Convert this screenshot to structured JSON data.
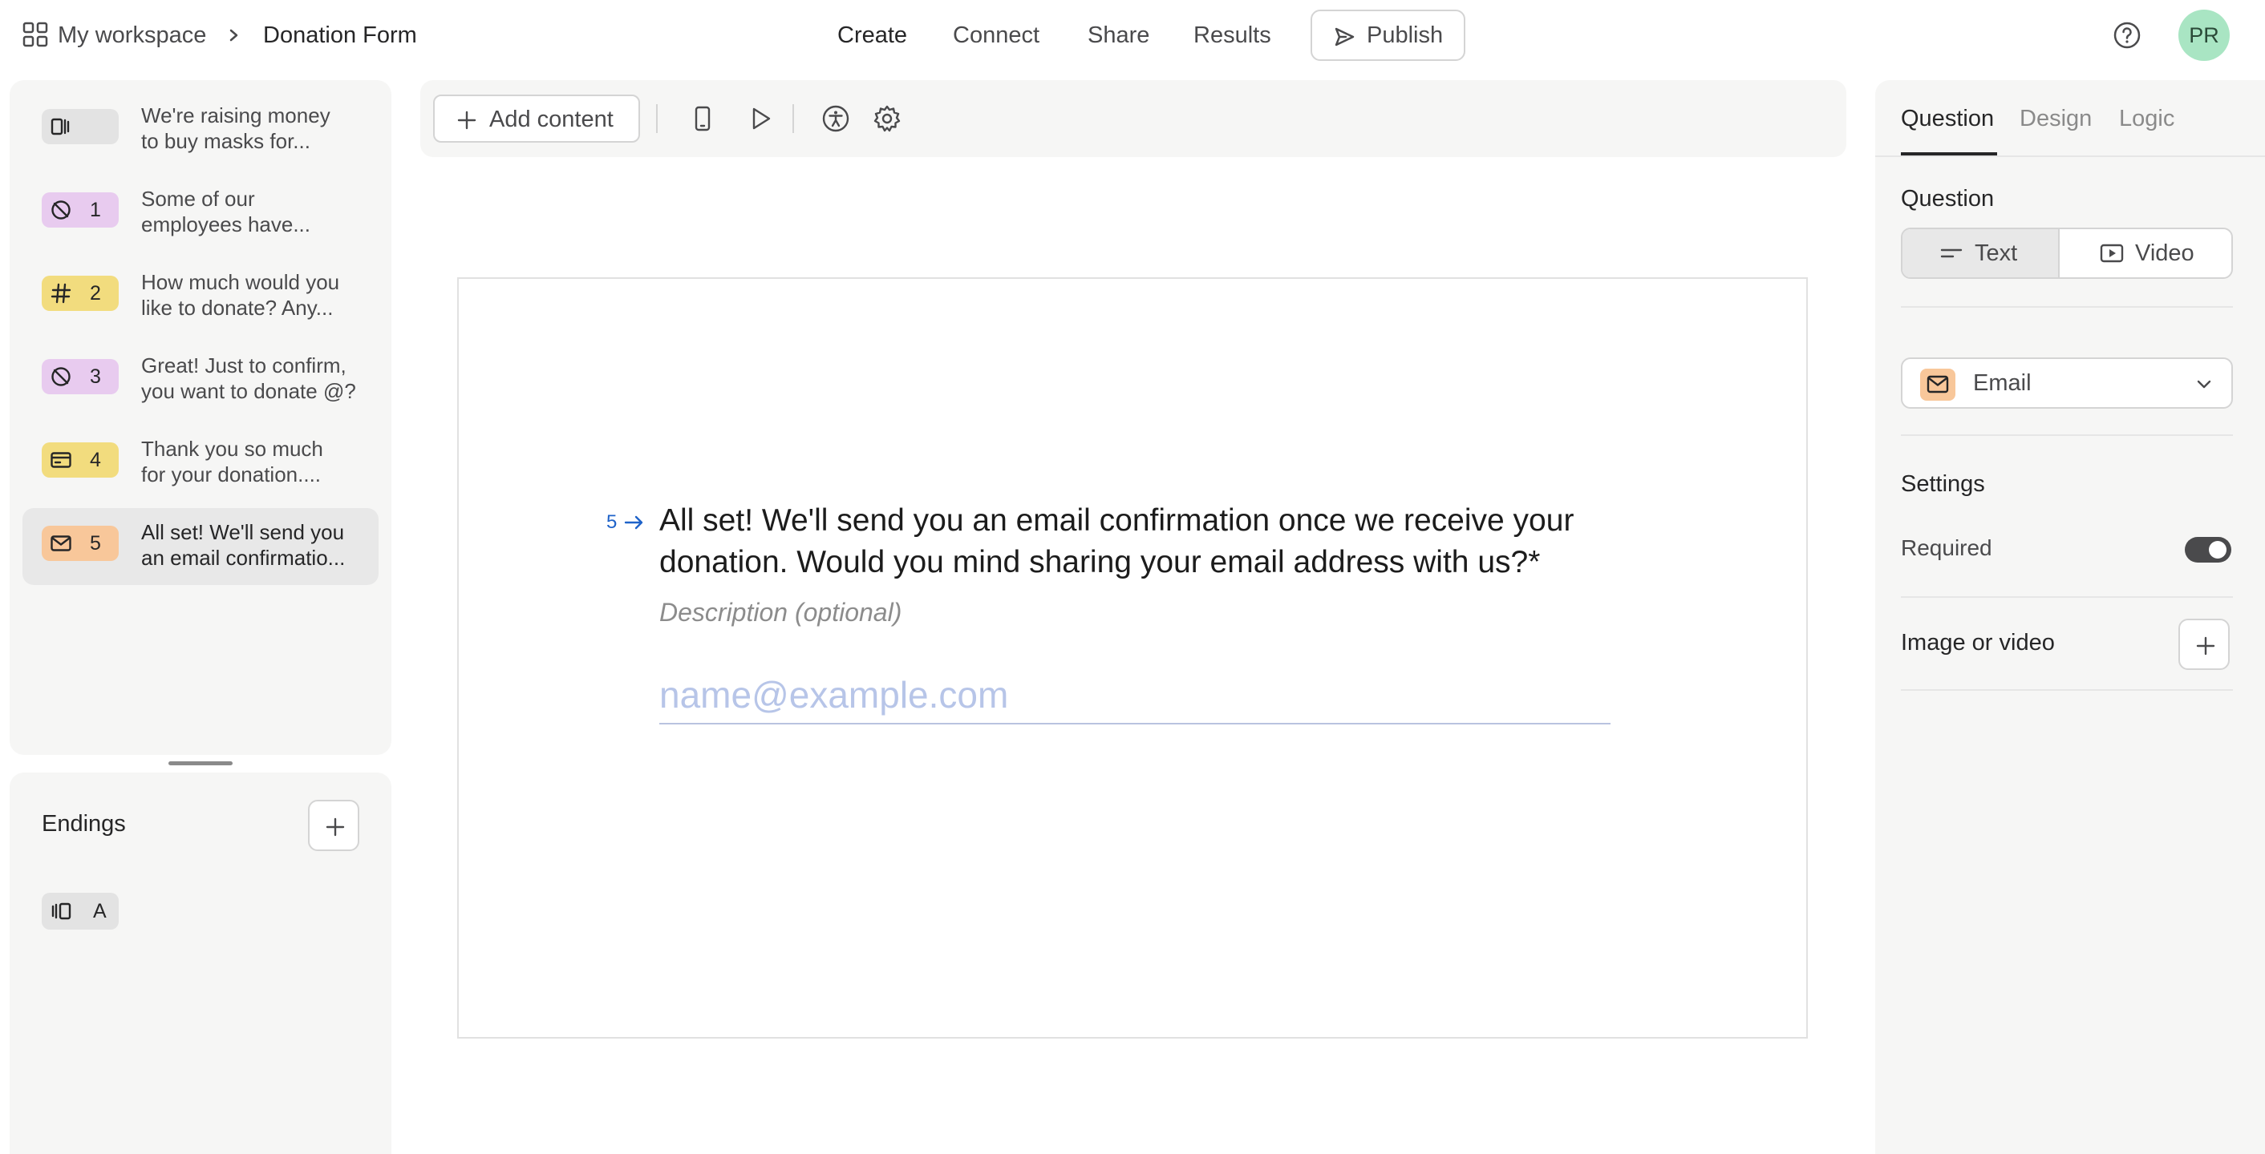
{
  "breadcrumb": {
    "workspace": "My workspace",
    "form": "Donation Form"
  },
  "nav": {
    "create": "Create",
    "connect": "Connect",
    "share": "Share",
    "results": "Results",
    "publish": "Publish"
  },
  "user": {
    "initials": "PR"
  },
  "questions": [
    {
      "number": "",
      "line1": "We're raising money",
      "line2": "to buy masks for...",
      "icon": "statement-icon",
      "color": "#e3e3e3"
    },
    {
      "number": "1",
      "line1": "Some of our",
      "line2": "employees have...",
      "icon": "no-symbol-icon",
      "color": "#e8cbef"
    },
    {
      "number": "2",
      "line1": "How much would you",
      "line2": "like to donate? Any...",
      "icon": "hash-icon",
      "color": "#f2dc7e"
    },
    {
      "number": "3",
      "line1": "Great! Just to confirm,",
      "line2": "you want to donate @?",
      "icon": "no-symbol-icon",
      "color": "#e8cbef"
    },
    {
      "number": "4",
      "line1": "Thank you so much",
      "line2": "for your donation....",
      "icon": "payment-card-icon",
      "color": "#f2dc7e"
    },
    {
      "number": "5",
      "line1": "All set! We'll send you",
      "line2": "an email confirmatio...",
      "icon": "email-icon",
      "color": "#f8c79a"
    }
  ],
  "endings": {
    "title": "Endings",
    "items": [
      {
        "label": "A",
        "icon": "ending-icon"
      }
    ]
  },
  "toolbar": {
    "add_content": "Add content"
  },
  "question": {
    "number": "5",
    "title_line1": "All set! We'll send you an email confirmation once we receive your",
    "title_line2": "donation. Would you mind sharing your email address with us?*",
    "description_placeholder": "Description (optional)",
    "answer_placeholder": "name@example.com"
  },
  "panel": {
    "tabs": [
      "Question",
      "Design",
      "Logic"
    ],
    "question_heading": "Question",
    "type_text": "Text",
    "type_video": "Video",
    "field_type": "Email",
    "settings_heading": "Settings",
    "required_label": "Required",
    "required": true,
    "media_label": "Image or video"
  },
  "colors": {
    "accent_blue": "#1f63c9",
    "email_badge": "#f8c79a",
    "avatar": "#a9e5c3"
  }
}
